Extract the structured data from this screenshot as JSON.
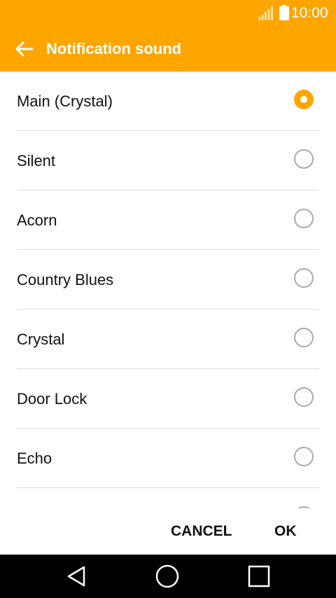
{
  "status_bar": {
    "time": "10:00",
    "signal_icon": "signal-bars-icon",
    "battery_icon": "battery-full-icon"
  },
  "app_bar": {
    "title": "Notification sound",
    "back_icon": "arrow-left-icon"
  },
  "sounds": [
    {
      "label": "Main (Crystal)",
      "selected": true
    },
    {
      "label": "Silent",
      "selected": false
    },
    {
      "label": "Acorn",
      "selected": false
    },
    {
      "label": "Country Blues",
      "selected": false
    },
    {
      "label": "Crystal",
      "selected": false
    },
    {
      "label": "Door Lock",
      "selected": false
    },
    {
      "label": "Echo",
      "selected": false
    },
    {
      "label": "",
      "selected": false
    }
  ],
  "dialog": {
    "cancel_label": "CANCEL",
    "ok_label": "OK"
  },
  "nav_bar": {
    "back_icon": "triangle-back-icon",
    "home_icon": "circle-home-icon",
    "recents_icon": "square-recents-icon"
  },
  "colors": {
    "accent": "#FFA500",
    "nav_bar": "#000000",
    "divider": "#dddddd",
    "radio_unchecked": "#aaaaaa"
  }
}
